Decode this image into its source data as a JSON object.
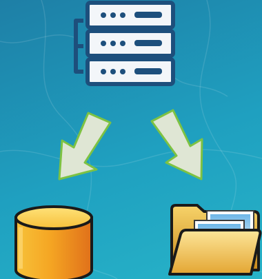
{
  "diagram": {
    "background_color": "#1f97b9",
    "nodes": [
      {
        "id": "server",
        "icon": "server-rack-icon",
        "rack_units": 3
      },
      {
        "id": "database",
        "icon": "database-cylinder-icon"
      },
      {
        "id": "folder",
        "icon": "image-folder-icon"
      }
    ],
    "edges": [
      {
        "from": "server",
        "to": "database"
      },
      {
        "from": "server",
        "to": "folder"
      }
    ],
    "colors": {
      "server_fill": "#f3f6f9",
      "server_outline": "#1d4f7c",
      "arrow_fill": "#dfe6d4",
      "arrow_outline": "#7dc243",
      "database_orange": "#f39a1a",
      "folder_gold": "#e8b53a"
    }
  }
}
